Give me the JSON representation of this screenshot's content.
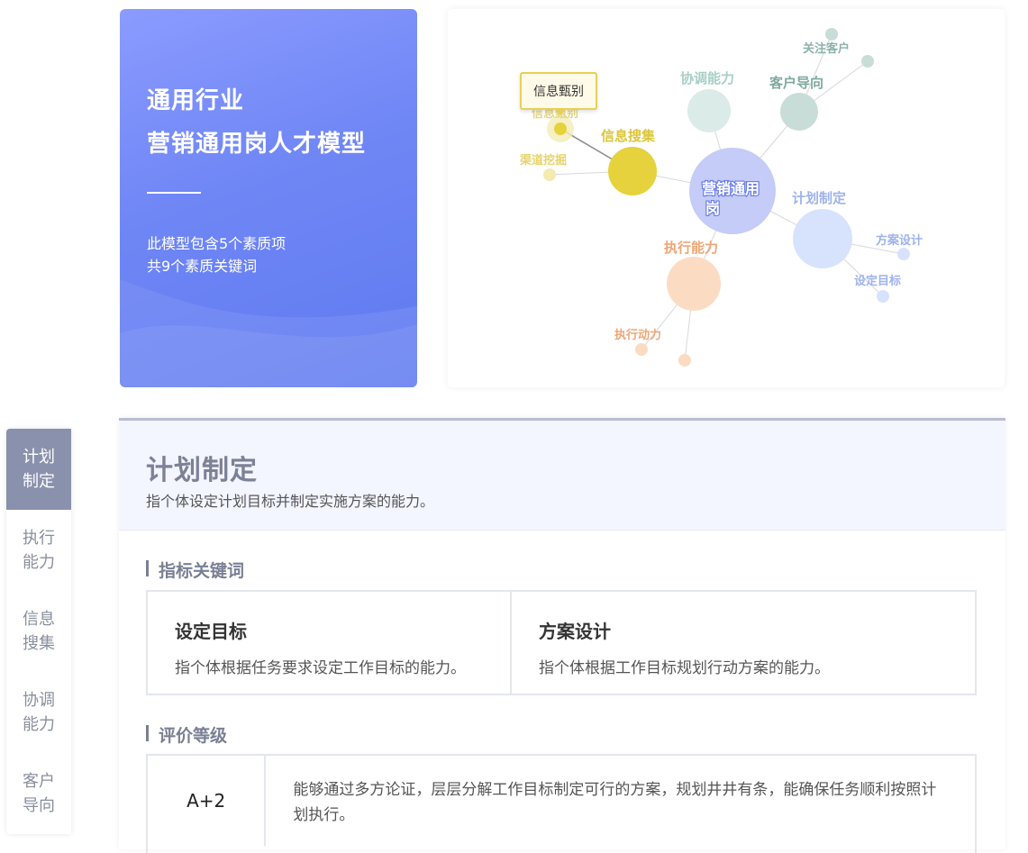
{
  "hero": {
    "title_line1": "通用行业",
    "title_line2": "营销通用岗人才模型",
    "desc_line1": "此模型包含5个素质项",
    "desc_line2": "共9个素质关键词"
  },
  "graph": {
    "tooltip": "信息甄别",
    "nodes": {
      "center": "营销通用岗",
      "center_l1": "营销通用",
      "center_l2": "岗",
      "info_collect": "信息搜集",
      "info_screen": "信息甄别",
      "channel_mining": "渠道挖掘",
      "coordination": "协调能力",
      "customer_orient": "客户导向",
      "focus_customer": "关注客户",
      "plan_make": "计划制定",
      "plan_design": "方案设计",
      "set_goal": "设定目标",
      "execution": "执行能力",
      "exec_drive": "执行动力"
    },
    "colors": {
      "center": "#c4ccf7",
      "info": "#e5d23c",
      "coord": "#dbebe8",
      "customer": "#c9ddd8",
      "plan": "#d7e3fd",
      "exec": "#fbdcc3"
    }
  },
  "sidenav": {
    "items": [
      {
        "l1": "计划",
        "l2": "制定",
        "active": true
      },
      {
        "l1": "执行",
        "l2": "能力",
        "active": false
      },
      {
        "l1": "信息",
        "l2": "搜集",
        "active": false
      },
      {
        "l1": "协调",
        "l2": "能力",
        "active": false
      },
      {
        "l1": "客户",
        "l2": "导向",
        "active": false
      }
    ]
  },
  "panel": {
    "title": "计划制定",
    "subtitle": "指个体设定计划目标并制定实施方案的能力。",
    "keywords_heading": "指标关键词",
    "keywords": [
      {
        "name": "设定目标",
        "desc": "指个体根据任务要求设定工作目标的能力。"
      },
      {
        "name": "方案设计",
        "desc": "指个体根据工作目标规划行动方案的能力。"
      }
    ],
    "levels_heading": "评价等级",
    "levels": [
      {
        "grade": "A+2",
        "desc": "能够通过多方论证，层层分解工作目标制定可行的方案，规划井井有条，能确保任务顺利按照计划执行。"
      }
    ]
  }
}
